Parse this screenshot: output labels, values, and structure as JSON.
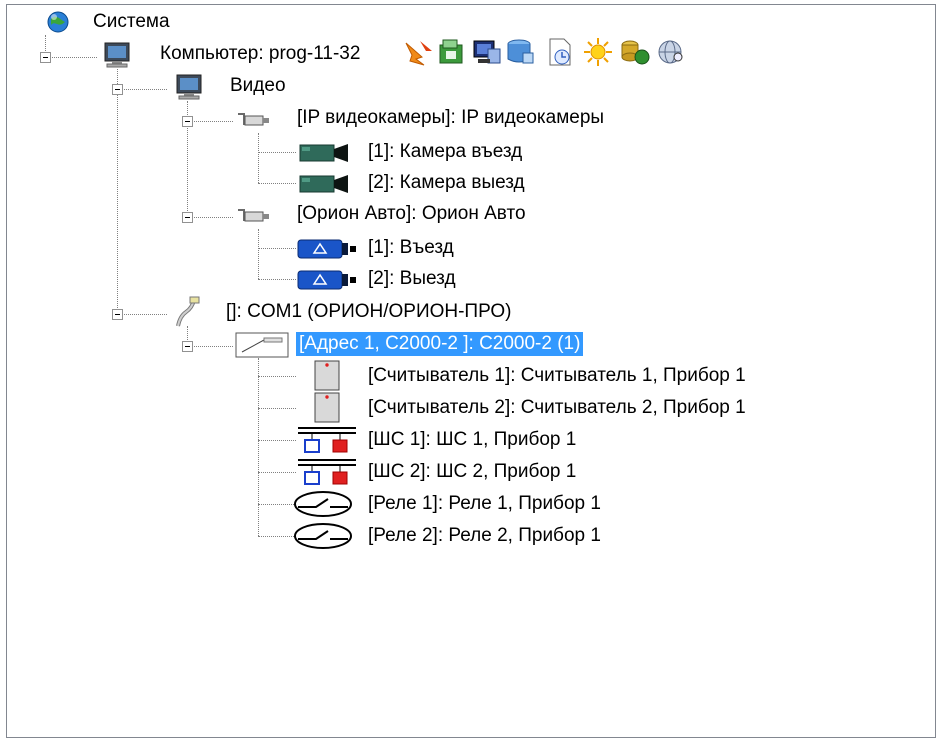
{
  "tree": {
    "root": "Система",
    "computer": "Компьютер: prog-11-32",
    "video": "Видео",
    "ip_cameras": "[IP видеокамеры]: IP видеокамеры",
    "cam1": "[1]: Камера въезд",
    "cam2": "[2]: Камера выезд",
    "orion_auto": "[Орион Авто]: Орион Авто",
    "entry": "[1]: Въезд",
    "exit": "[2]: Выезд",
    "com1": "[]: COM1 (ОРИОН/ОРИОН-ПРО)",
    "c2000": "[Адрес 1, С2000-2 ]: С2000-2 (1)",
    "reader1": "[Считыватель 1]: Считыватель 1, Прибор 1",
    "reader2": "[Считыватель 2]: Считыватель 2, Прибор 1",
    "loop1": "[ШС 1]: ШС 1, Прибор 1",
    "loop2": "[ШС 2]: ШС 2, Прибор 1",
    "relay1": "[Реле 1]: Реле 1, Прибор 1",
    "relay2": "[Реле 2]: Реле 2, Прибор 1"
  },
  "toolbar_icons": [
    "arrow-icon",
    "add-folder-icon",
    "monitor-icon",
    "database-icon",
    "clock-page-icon",
    "sun-icon",
    "coins-icon",
    "globe-search-icon"
  ],
  "colors": {
    "selection": "#3399ff",
    "camera_green": "#2f6a5a",
    "camera_blue": "#1a55c8"
  }
}
